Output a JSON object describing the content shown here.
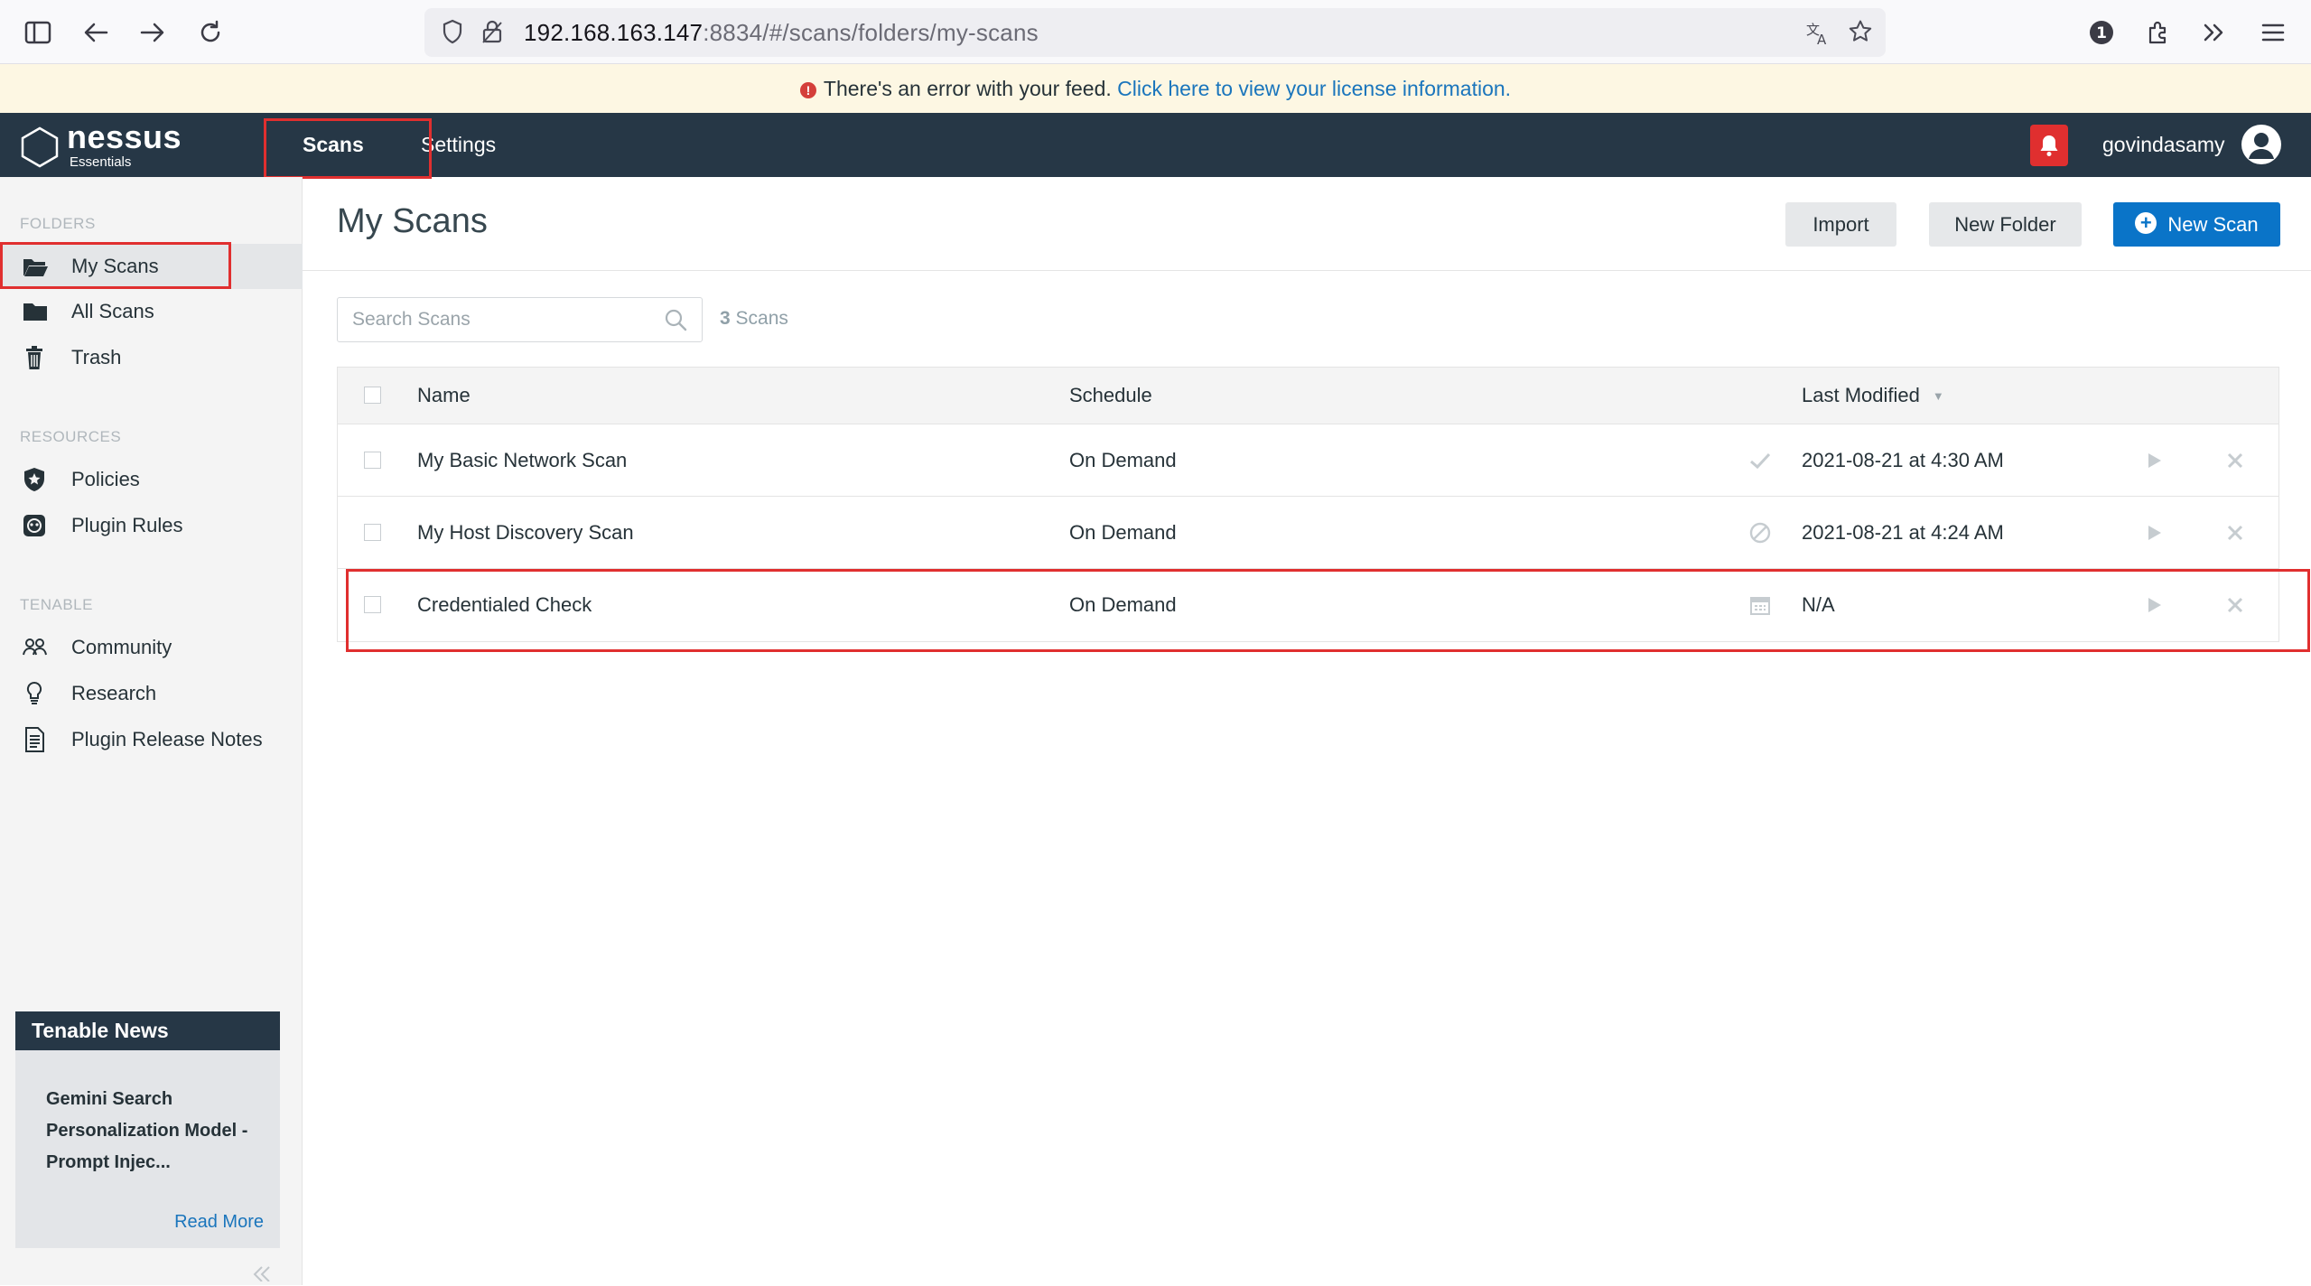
{
  "browser": {
    "url_host": "192.168.163.147",
    "url_rest": ":8834/#/scans/folders/my-scans",
    "extension_badge": "1"
  },
  "banner": {
    "message": "There's an error with your feed.",
    "link": "Click here to view your license information."
  },
  "header": {
    "logo_name": "nessus",
    "logo_sub": "Essentials",
    "tabs": [
      {
        "label": "Scans"
      },
      {
        "label": "Settings"
      }
    ],
    "username": "govindasamy"
  },
  "sidebar": {
    "folders_label": "FOLDERS",
    "folders": [
      {
        "label": "My Scans"
      },
      {
        "label": "All Scans"
      },
      {
        "label": "Trash"
      }
    ],
    "resources_label": "RESOURCES",
    "resources": [
      {
        "label": "Policies"
      },
      {
        "label": "Plugin Rules"
      }
    ],
    "tenable_label": "TENABLE",
    "tenable": [
      {
        "label": "Community"
      },
      {
        "label": "Research"
      },
      {
        "label": "Plugin Release Notes"
      }
    ],
    "news": {
      "heading": "Tenable News",
      "title": "Gemini Search Personalization Model - Prompt Injec...",
      "read_more": "Read More"
    }
  },
  "main": {
    "title": "My Scans",
    "buttons": {
      "import": "Import",
      "new_folder": "New Folder",
      "new_scan": "New Scan"
    },
    "search_placeholder": "Search Scans",
    "count_number": "3",
    "count_label": "Scans",
    "columns": {
      "name": "Name",
      "schedule": "Schedule",
      "last_modified": "Last Modified"
    },
    "rows": [
      {
        "name": "My Basic Network Scan",
        "schedule": "On Demand",
        "status_icon": "check-icon",
        "modified": "2021-08-21 at 4:30 AM"
      },
      {
        "name": "My Host Discovery Scan",
        "schedule": "On Demand",
        "status_icon": "canceled-icon",
        "modified": "2021-08-21 at 4:24 AM"
      },
      {
        "name": "Credentialed Check",
        "schedule": "On Demand",
        "status_icon": "calendar-icon",
        "modified": "N/A"
      }
    ]
  },
  "colors": {
    "header_bg": "#263746",
    "accent_blue": "#0a74c8",
    "highlight_red": "#e02f2f",
    "banner_bg": "#fdf7e3"
  }
}
